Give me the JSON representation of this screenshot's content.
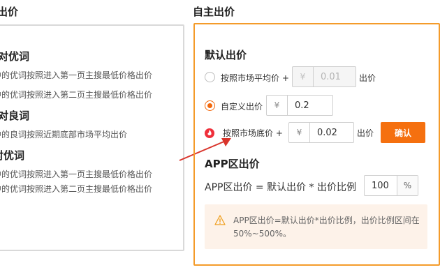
{
  "left": {
    "title": "出价",
    "sections": [
      {
        "heading": "针对优词",
        "lines": [
          "中的优词按照进入第一页主搜最低价格出价",
          "中的优词按照进入第二页主搜最低价格出价"
        ]
      },
      {
        "heading": "针对良词",
        "lines": [
          "中的良词按照近期底部市场平均出价"
        ]
      },
      {
        "heading": "对优词",
        "lines": [
          "中的优词按照进入第一页主搜最低价格出价",
          "中的优词按照进入第二页主搜最低价格出价"
        ]
      }
    ]
  },
  "right": {
    "title": "自主出价",
    "default_bid": {
      "title": "默认出价",
      "options": [
        {
          "label": "按照市场平均价 +",
          "currency": "¥",
          "value": "0.01",
          "suffix": "出价",
          "checked": false,
          "disabled": true
        },
        {
          "label": "自定义出价",
          "currency": "¥",
          "value": "0.2",
          "checked": true,
          "disabled": false
        },
        {
          "label": "按照市场底价 +",
          "currency": "¥",
          "value": "0.02",
          "suffix": "出价",
          "checked": false,
          "disabled": false,
          "icon": "fire-icon"
        }
      ],
      "confirm_label": "确认"
    },
    "app_bid": {
      "title": "APP区出价",
      "formula": "APP区出价 = 默认出价 * 出价比例",
      "ratio_value": "100",
      "ratio_unit": "%",
      "tip": "APP区出价=默认出价*出价比例，出价比例区间在50%~500%。"
    }
  },
  "colors": {
    "accent": "#f5700f",
    "highlight_border": "#f49b2a",
    "arrow": "#d9342b",
    "tip_bg": "#fdf2e9"
  }
}
